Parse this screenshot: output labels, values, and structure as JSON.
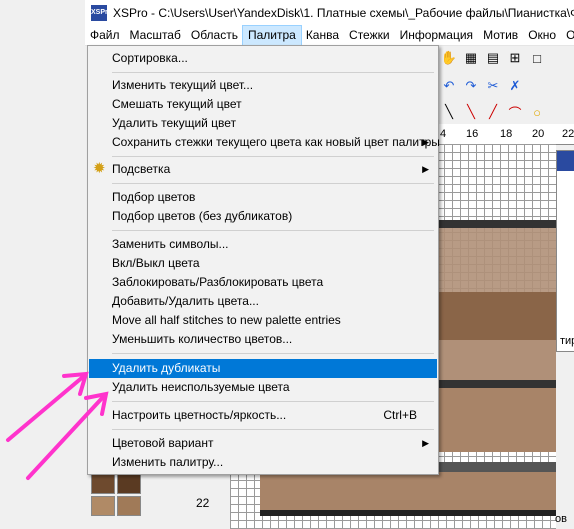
{
  "window": {
    "title": "XSPro - C:\\Users\\User\\YandexDisk\\1. Платные схемы\\_Рабочие файлы\\Пианистка\\ФР",
    "icon_label": "XSPro",
    "accent_color": "#0078d7",
    "annotation_color": "#ff33cc"
  },
  "menubar": {
    "items": [
      "Файл",
      "Масштаб",
      "Область",
      "Палитра",
      "Канва",
      "Стежки",
      "Информация",
      "Мотив",
      "Окно",
      "От"
    ]
  },
  "menu": {
    "items": [
      {
        "label": "Сортировка..."
      },
      {
        "label": "Изменить текущий цвет..."
      },
      {
        "label": "Смешать текущий цвет"
      },
      {
        "label": "Удалить текущий цвет"
      },
      {
        "label": "Сохранить стежки текущего цвета как новый цвет палитры",
        "submenu": true
      },
      {
        "label": "Подсветка",
        "submenu": true,
        "icon": "gear-icon"
      },
      {
        "label": "Подбор цветов"
      },
      {
        "label": "Подбор цветов (без дубликатов)"
      },
      {
        "label": "Заменить символы..."
      },
      {
        "label": "Вкл/Выкл цвета"
      },
      {
        "label": "Заблокировать/Разблокировать цвета"
      },
      {
        "label": "Добавить/Удалить цвета..."
      },
      {
        "label": "Move all half stitches to new palette entries"
      },
      {
        "label": "Уменьшить количество цветов..."
      },
      {
        "label": "Удалить дубликаты",
        "highlighted": true
      },
      {
        "label": "Удалить неиспользуемые цвета"
      },
      {
        "label": "Настроить цветность/яркость...",
        "shortcut": "Ctrl+B"
      },
      {
        "label": "Цветовой вариант",
        "submenu": true
      },
      {
        "label": "Изменить палитру..."
      }
    ]
  },
  "ruler": {
    "ticks": [
      "4",
      "16",
      "18",
      "20",
      "22"
    ]
  },
  "row_number": "22",
  "side_label": "тир",
  "status_fragment": "ов",
  "icons": [
    "hand-icon",
    "grid-icon",
    "undo-icon",
    "redo-icon",
    "line-tool-icon",
    "eraser-icon",
    "scissors-icon"
  ]
}
